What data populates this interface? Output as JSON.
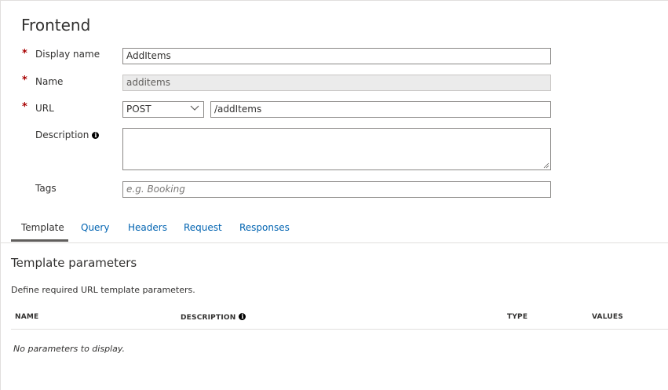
{
  "section": {
    "title": "Frontend"
  },
  "form": {
    "display_name": {
      "label": "Display name",
      "required_mark": "*",
      "value": "AddItems"
    },
    "name": {
      "label": "Name",
      "required_mark": "*",
      "value": "additems"
    },
    "url": {
      "label": "URL",
      "required_mark": "*",
      "method": "POST",
      "path": "/addItems"
    },
    "description": {
      "label": "Description",
      "info_icon": "info-icon",
      "value": ""
    },
    "tags": {
      "label": "Tags",
      "placeholder": "e.g. Booking"
    }
  },
  "tabs": [
    {
      "label": "Template",
      "active": true
    },
    {
      "label": "Query",
      "active": false
    },
    {
      "label": "Headers",
      "active": false
    },
    {
      "label": "Request",
      "active": false
    },
    {
      "label": "Responses",
      "active": false
    }
  ],
  "template_params": {
    "title": "Template parameters",
    "description": "Define required URL template parameters.",
    "columns": [
      "NAME",
      "DESCRIPTION",
      "TYPE",
      "VALUES"
    ],
    "empty_message": "No parameters to display."
  },
  "colors": {
    "accent_link": "#0063b1",
    "required": "#a80000",
    "border": "#8a8886",
    "disabled_bg": "#ebebeb"
  }
}
